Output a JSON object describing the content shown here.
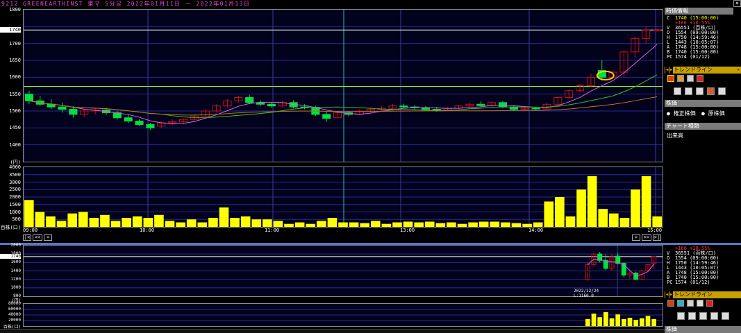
{
  "title": "9212 GREENEARTHINST 東マ 5分足 2022年01月11日 ～ 2022年01月13日",
  "colors": {
    "up": "#cc1010",
    "down": "#00e040",
    "volume": "#ffff00",
    "ma_short": "#e060e0",
    "ma_mid": "#30c030",
    "ma_long": "#c07020",
    "hline_green": "#80ff20",
    "cursor": "#20c0c0",
    "grid": "#2a2a8a"
  },
  "price_axis": {
    "labels": [
      "1800",
      "1740",
      "1700",
      "1650",
      "1600",
      "1550",
      "1500",
      "1450",
      "1400",
      "(円)"
    ],
    "current": "1740"
  },
  "volume_axis": {
    "labels": [
      "4000",
      "3500",
      "3000",
      "2500",
      "2000",
      "1500",
      "1000",
      "500",
      "百株(口)"
    ]
  },
  "time_axis": {
    "labels": [
      "09:00",
      "10:00",
      "11:00",
      "13:00",
      "14:00",
      "15:00"
    ]
  },
  "nav": {
    "first": "|<",
    "prev_page": "<<",
    "prev": "<",
    "next": ">",
    "next_page": ">>",
    "last": ">|"
  },
  "chart_data": [
    {
      "type": "candlestick",
      "name": "intraday-5min",
      "ylim": [
        1350,
        1800
      ],
      "ohlc": [
        [
          1550,
          1560,
          1520,
          1530
        ],
        [
          1530,
          1545,
          1515,
          1520
        ],
        [
          1520,
          1535,
          1505,
          1512
        ],
        [
          1512,
          1525,
          1495,
          1505
        ],
        [
          1505,
          1515,
          1480,
          1490
        ],
        [
          1490,
          1505,
          1482,
          1500
        ],
        [
          1500,
          1508,
          1490,
          1503
        ],
        [
          1503,
          1510,
          1488,
          1495
        ],
        [
          1495,
          1500,
          1475,
          1480
        ],
        [
          1480,
          1490,
          1465,
          1470
        ],
        [
          1470,
          1475,
          1455,
          1460
        ],
        [
          1460,
          1465,
          1443,
          1450
        ],
        [
          1455,
          1470,
          1450,
          1465
        ],
        [
          1465,
          1475,
          1458,
          1468
        ],
        [
          1468,
          1478,
          1460,
          1475
        ],
        [
          1475,
          1490,
          1470,
          1485
        ],
        [
          1485,
          1505,
          1480,
          1500
        ],
        [
          1500,
          1520,
          1495,
          1515
        ],
        [
          1515,
          1535,
          1510,
          1530
        ],
        [
          1530,
          1545,
          1525,
          1540
        ],
        [
          1540,
          1548,
          1520,
          1525
        ],
        [
          1525,
          1532,
          1515,
          1520
        ],
        [
          1520,
          1525,
          1510,
          1515
        ],
        [
          1515,
          1530,
          1510,
          1525
        ],
        [
          1525,
          1532,
          1508,
          1512
        ],
        [
          1512,
          1520,
          1505,
          1510
        ],
        [
          1510,
          1515,
          1485,
          1490
        ],
        [
          1490,
          1498,
          1468,
          1478
        ],
        [
          1480,
          1500,
          1478,
          1495
        ],
        [
          1495,
          1500,
          1485,
          1490
        ],
        [
          1490,
          1505,
          1488,
          1500
        ],
        [
          1500,
          1510,
          1495,
          1505
        ],
        [
          1505,
          1515,
          1500,
          1508
        ],
        [
          1508,
          1520,
          1505,
          1515
        ],
        [
          1515,
          1522,
          1508,
          1512
        ],
        [
          1512,
          1518,
          1505,
          1510
        ],
        [
          1510,
          1515,
          1500,
          1505
        ],
        [
          1505,
          1512,
          1498,
          1503
        ],
        [
          1503,
          1512,
          1500,
          1508
        ],
        [
          1508,
          1518,
          1505,
          1515
        ],
        [
          1515,
          1525,
          1510,
          1520
        ],
        [
          1520,
          1528,
          1512,
          1516
        ],
        [
          1516,
          1528,
          1512,
          1525
        ],
        [
          1525,
          1530,
          1508,
          1512
        ],
        [
          1512,
          1516,
          1500,
          1505
        ],
        [
          1505,
          1510,
          1500,
          1508
        ],
        [
          1508,
          1512,
          1503,
          1506
        ],
        [
          1506,
          1525,
          1505,
          1520
        ],
        [
          1520,
          1545,
          1518,
          1540
        ],
        [
          1540,
          1565,
          1535,
          1560
        ],
        [
          1560,
          1580,
          1555,
          1575
        ],
        [
          1575,
          1610,
          1570,
          1600
        ],
        [
          1620,
          1650,
          1590,
          1600
        ],
        [
          1600,
          1620,
          1595,
          1615
        ],
        [
          1615,
          1680,
          1600,
          1675
        ],
        [
          1675,
          1720,
          1660,
          1715
        ],
        [
          1715,
          1750,
          1700,
          1740
        ],
        [
          1740,
          1745,
          1735,
          1740
        ]
      ],
      "lines": {
        "hline_1740": 1740,
        "hline_green": 1573
      }
    },
    {
      "type": "bar",
      "name": "volume",
      "unit": "百株(口)",
      "ylim": [
        0,
        4000
      ],
      "values": [
        1800,
        1000,
        700,
        400,
        900,
        1000,
        600,
        800,
        400,
        600,
        700,
        600,
        800,
        400,
        300,
        500,
        300,
        600,
        1300,
        600,
        700,
        500,
        500,
        400,
        200,
        300,
        200,
        400,
        600,
        300,
        300,
        250,
        400,
        200,
        300,
        350,
        300,
        350,
        250,
        300,
        200,
        300,
        350,
        350,
        300,
        250,
        200,
        300,
        1700,
        2000,
        700,
        2500,
        3400,
        1200,
        900,
        600,
        2500,
        3400,
        700
      ]
    },
    {
      "type": "candlestick",
      "name": "daily-mini",
      "ylim": [
        1000,
        1900
      ],
      "ohlc": [
        [
          1200,
          1600,
          1160,
          1550
        ],
        [
          1550,
          1820,
          1500,
          1800
        ],
        [
          1800,
          1850,
          1600,
          1650
        ],
        [
          1650,
          1800,
          1420,
          1460
        ],
        [
          1460,
          1780,
          1400,
          1750
        ],
        [
          1750,
          1820,
          1550,
          1580
        ],
        [
          1580,
          1600,
          1250,
          1300
        ],
        [
          1300,
          1400,
          1200,
          1350
        ],
        [
          1350,
          1380,
          1180,
          1200
        ],
        [
          1200,
          1420,
          1190,
          1400
        ],
        [
          1400,
          1560,
          1380,
          1550
        ],
        [
          1574,
          1750,
          1443,
          1740
        ]
      ],
      "annotations": {
        "date": "2022/12/24",
        "low": "L:1160.0"
      }
    },
    {
      "type": "bar",
      "name": "daily-volume",
      "ylim": [
        0,
        80000
      ],
      "values": [
        25000,
        45000,
        32000,
        50000,
        28000,
        42000,
        25000,
        30000,
        22000,
        28000,
        36551,
        25000
      ]
    }
  ],
  "mini_axis": {
    "price_labels": [
      "2000",
      "1800",
      "1740",
      "1600",
      "1400",
      "1200",
      "1000",
      "800",
      "(円)"
    ],
    "vol_labels": [
      "80000",
      "60000",
      "40000",
      "20000",
      "百株(口)"
    ]
  },
  "panel": {
    "header": "時価情報",
    "quote": [
      {
        "k": "C",
        "v": "1740 (15:00:00)"
      },
      {
        "k": "",
        "v": "+166 +10.55%"
      },
      {
        "k": "V",
        "v": "36551 (百株/口)"
      },
      {
        "k": "O",
        "v": "1554 (09:00:00)"
      },
      {
        "k": "H",
        "v": "1750 (14:59:46)"
      },
      {
        "k": "L",
        "v": "1443 (10:05:07)"
      },
      {
        "k": "A",
        "v": "1748 (15:00:00)"
      },
      {
        "k": "B",
        "v": "1740 (15:00:00)"
      },
      {
        "k": "PC",
        "v": "1574 (01/12)"
      }
    ],
    "trendline_label": "トレンドライン",
    "kabuka_header": "株価",
    "radio1": "権正株価",
    "radio2": "原株価",
    "chart_kind_header": "チャート種類",
    "chart_kind_value": "出来高"
  },
  "panel2": {
    "quote": [
      {
        "k": "",
        "v": "+166 +10.55%"
      },
      {
        "k": "V",
        "v": "36551 (百株/口)"
      },
      {
        "k": "O",
        "v": "1554 (09:00:00)"
      },
      {
        "k": "H",
        "v": "1750 (14:59:46)"
      },
      {
        "k": "L",
        "v": "1443 (10:05:07)"
      },
      {
        "k": "A",
        "v": "1748 (15:00:00)"
      },
      {
        "k": "B",
        "v": "1740 (15:00:00)"
      },
      {
        "k": "PC",
        "v": "1574 (01/12)"
      }
    ],
    "trendline_label": "トレンドライン",
    "kabuka_header": "株価"
  }
}
